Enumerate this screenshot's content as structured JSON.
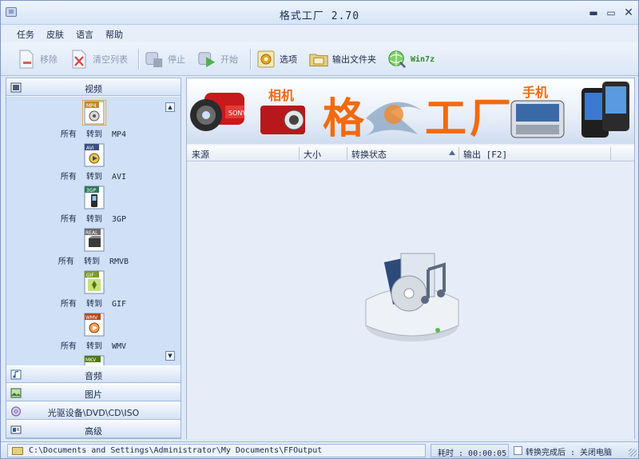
{
  "window": {
    "title": "格式工厂 2.70",
    "min": "▬",
    "max": "▭",
    "close": "✕"
  },
  "menu": [
    "任务",
    "皮肤",
    "语言",
    "帮助"
  ],
  "toolbar": {
    "remove": "移除",
    "clear": "清空列表",
    "stop": "停止",
    "start": "开始",
    "options": "选项",
    "output_folder": "输出文件夹",
    "win7z": "Win7z"
  },
  "sidebar": {
    "video_header": "视频",
    "video_items": [
      {
        "icon": "MP4",
        "label": "所有  转到  MP4",
        "selected": true
      },
      {
        "icon": "AVI",
        "label": "所有  转到  AVI",
        "selected": false
      },
      {
        "icon": "3GP",
        "label": "所有  转到  3GP",
        "selected": false
      },
      {
        "icon": "REAL",
        "label": "所有  转到  RMVB",
        "selected": false
      },
      {
        "icon": "GIF",
        "label": "所有  转到  GIF",
        "selected": false
      },
      {
        "icon": "WMV",
        "label": "所有  转到  WMV",
        "selected": false
      },
      {
        "icon": "MKV",
        "label": "",
        "selected": false
      }
    ],
    "audio_header": "音频",
    "image_header": "图片",
    "rom_header": "光驱设备\\DVD\\CD\\ISO",
    "advanced_header": "高级"
  },
  "banner": {
    "title_left": "格",
    "title_right": "工厂",
    "camera_label": "相机",
    "phone_label": "手机",
    "camera_brand": "SONY"
  },
  "table": {
    "col_source": "来源",
    "col_size": "大小",
    "col_status": "转换状态",
    "col_output": "输出 [F2]"
  },
  "status": {
    "path": "C:\\Documents and Settings\\Administrator\\My Documents\\FFOutput",
    "elapsed": "耗时 : 00:00:05",
    "after_convert": "转换完成后 : 关闭电脑"
  },
  "colors": {
    "accent_orange": "#f26a10",
    "frame_blue": "#7a96c2",
    "panel_blue": "#cfe0f7"
  }
}
